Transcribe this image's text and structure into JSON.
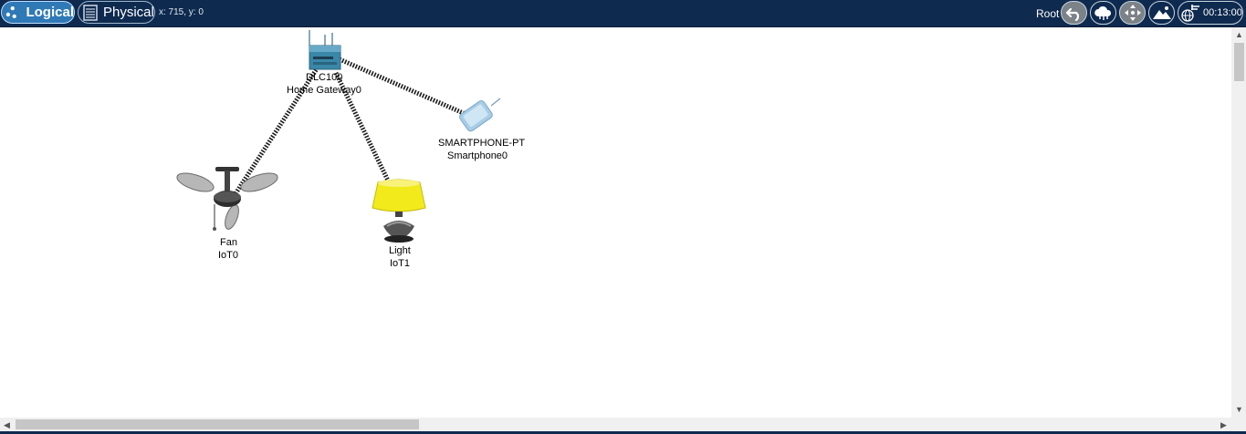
{
  "toolbar": {
    "logical_label": "Logical",
    "physical_label": "Physical",
    "coordinates": "x: 715, y: 0",
    "root_label": "Root",
    "clock": "00:13:00",
    "icons": [
      "logical-network-icon",
      "physical-rack-icon",
      "back-arrow-icon",
      "cloud-icon",
      "move-arrows-icon",
      "landscape-image-icon",
      "globe-clock-icon"
    ]
  },
  "devices": {
    "gateway": {
      "model": "DLC100",
      "name": "Home Gateway0"
    },
    "smartphone": {
      "model": "SMARTPHONE-PT",
      "name": "Smartphone0"
    },
    "fan": {
      "model": "Fan",
      "name": "IoT0"
    },
    "light": {
      "model": "Light",
      "name": "IoT1"
    }
  },
  "colors": {
    "topbar": "#0e2a4f",
    "logical_tab": "#2f79b6",
    "gateway": "#3a87a8",
    "lamp_shade": "#f2ea1a",
    "smartphone": "#a8cde6",
    "link": "#1a1a1a"
  }
}
